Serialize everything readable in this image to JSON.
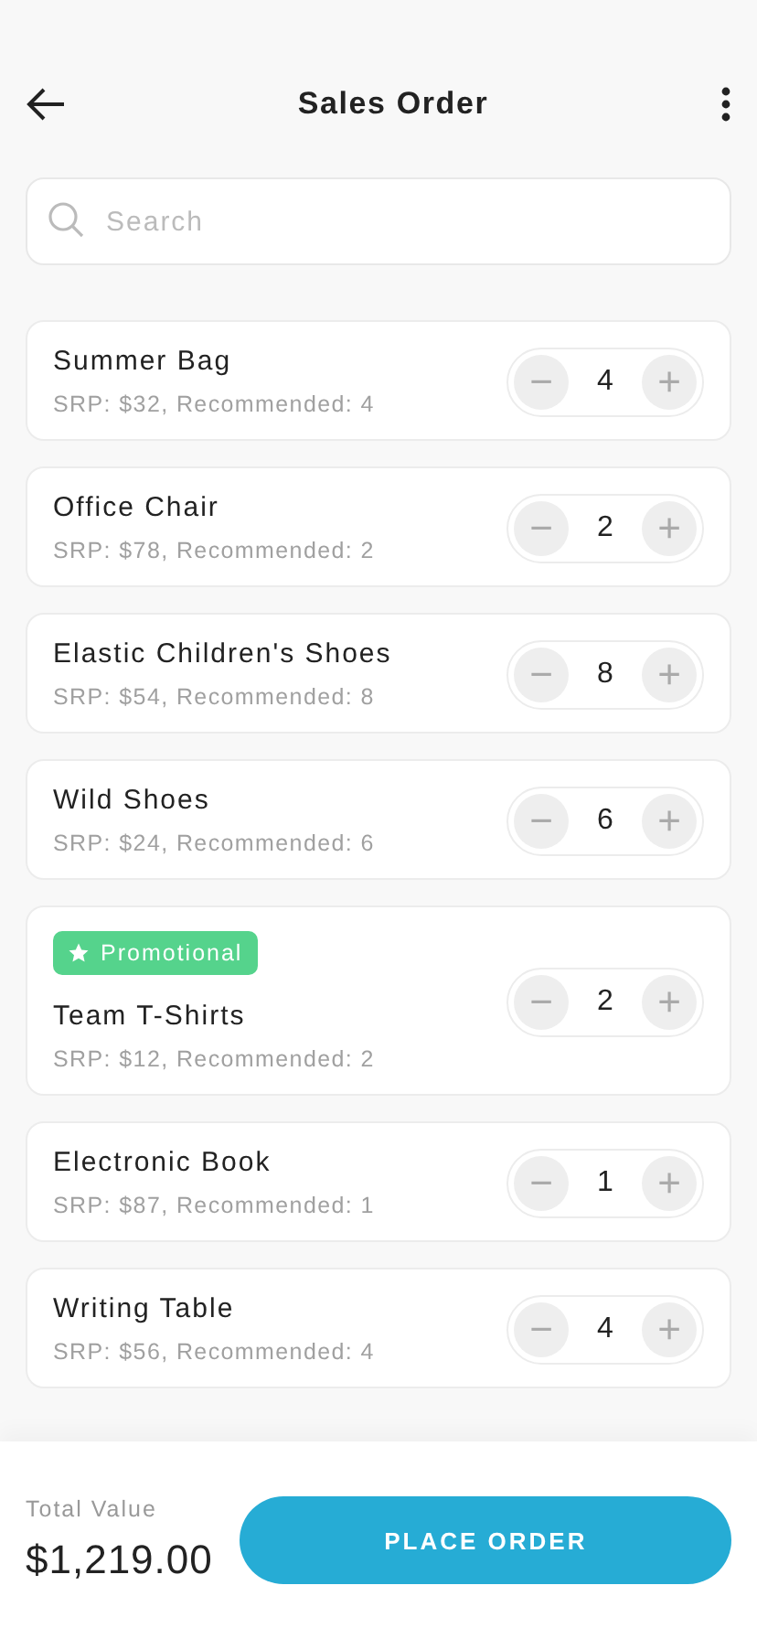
{
  "header": {
    "title": "Sales Order"
  },
  "search": {
    "placeholder": "Search"
  },
  "items": [
    {
      "name": "Summer Bag",
      "details": "SRP: $32, Recommended: 4",
      "quantity": "4",
      "minus": "−",
      "plus": "+"
    },
    {
      "name": "Office Chair",
      "details": "SRP: $78, Recommended: 2",
      "quantity": "2",
      "minus": "−",
      "plus": "+"
    },
    {
      "name": "Elastic Children's Shoes",
      "details": "SRP: $54, Recommended: 8",
      "quantity": "8",
      "minus": "−",
      "plus": "+"
    },
    {
      "name": "Wild Shoes",
      "details": "SRP: $24, Recommended: 6",
      "quantity": "6",
      "minus": "−",
      "plus": "+"
    },
    {
      "badge": "Promotional",
      "name": "Team T-Shirts",
      "details": "SRP: $12, Recommended: 2",
      "quantity": "2",
      "minus": "−",
      "plus": "+"
    },
    {
      "name": "Electronic Book",
      "details": "SRP: $87, Recommended: 1",
      "quantity": "1",
      "minus": "−",
      "plus": "+"
    },
    {
      "name": "Writing Table",
      "details": "SRP: $56, Recommended: 4",
      "quantity": "4",
      "minus": "−",
      "plus": "+"
    }
  ],
  "footer": {
    "total_label": "Total Value",
    "total": "$1,219.00",
    "button": "PLACE ORDER"
  }
}
